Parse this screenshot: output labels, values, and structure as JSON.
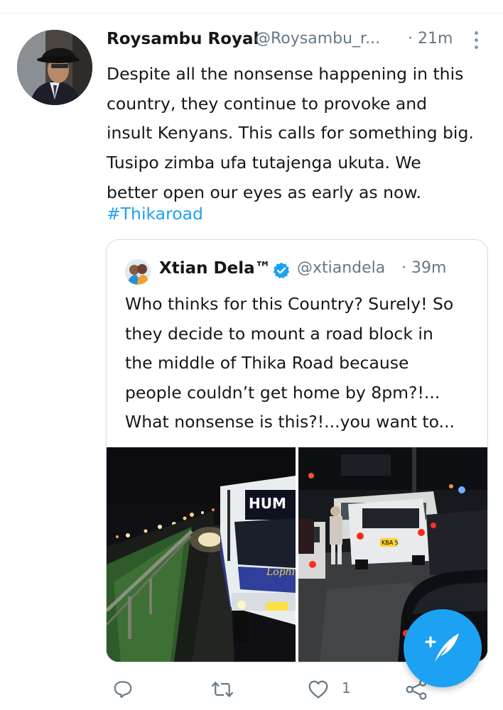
{
  "tweet": {
    "display_name": "Roysambu Royal",
    "handle": "@Roysambu_r...",
    "timestamp": "· 21m",
    "text": "Despite all the nonsense happening in this\ncountry,  they continue to provoke and\ninsult Kenyans. This calls for something big.\nTusipo zimba ufa tutajenga ukuta.  We\nbetter open our eyes as early as now.",
    "hashtag": "#Thikaroad",
    "avatar_icon": "profile-photo"
  },
  "quoted_tweet": {
    "display_name": "Xtian Dela™",
    "handle": "@xtiandela",
    "timestamp": "· 39m",
    "verified": true,
    "text": "Who thinks for this Country? Surely! So\nthey decide to mount a road block in\nthe middle of Thika Road because\npeople couldn’t get home by 8pm?!...\nWhat nonsense is this?!...you want to...",
    "bus_sign": "HUM",
    "bus_script": "Lophi",
    "plate": "KBA 5"
  },
  "actions": {
    "reply_icon": "reply-icon",
    "retweet_icon": "retweet-icon",
    "like_icon": "heart-icon",
    "like_count": "1",
    "share_icon": "share-icon"
  },
  "fab": {
    "icon": "compose-feather-icon"
  },
  "colors": {
    "accent": "#1da1f2",
    "text": "#14171a",
    "secondary": "#657786",
    "border": "#d6dde3"
  }
}
